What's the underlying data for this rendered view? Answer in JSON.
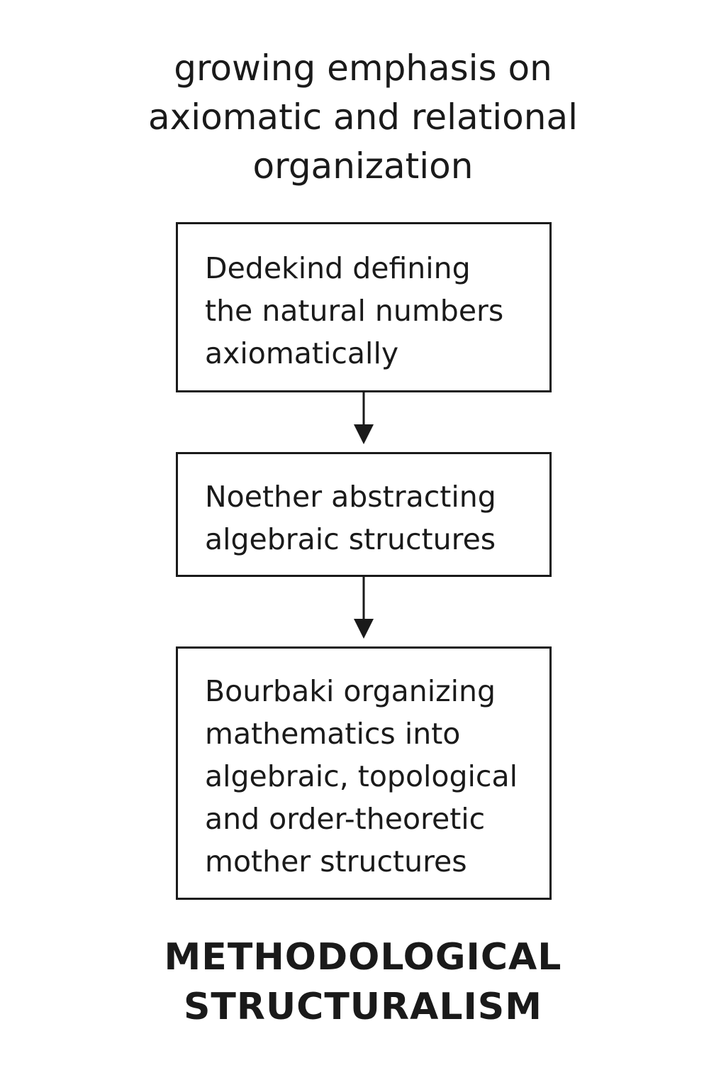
{
  "heading": {
    "lines": [
      "growing emphasis on",
      "axiomatic and relational",
      "organization"
    ]
  },
  "steps": [
    {
      "lines": [
        "Dedekind defining",
        "the natural numbers",
        "axiomatically"
      ]
    },
    {
      "lines": [
        "Noether abstracting",
        "algebraic structures"
      ]
    },
    {
      "lines": [
        "Bourbaki organizing",
        "mathematics into",
        "algebraic, topological",
        "and order-theoretic",
        "mother structures"
      ]
    }
  ],
  "footer": {
    "lines": [
      "METHODOLOGICAL",
      "STRUCTURALISM"
    ]
  },
  "colors": {
    "stroke": "#1a1a1a",
    "background": "#ffffff"
  }
}
